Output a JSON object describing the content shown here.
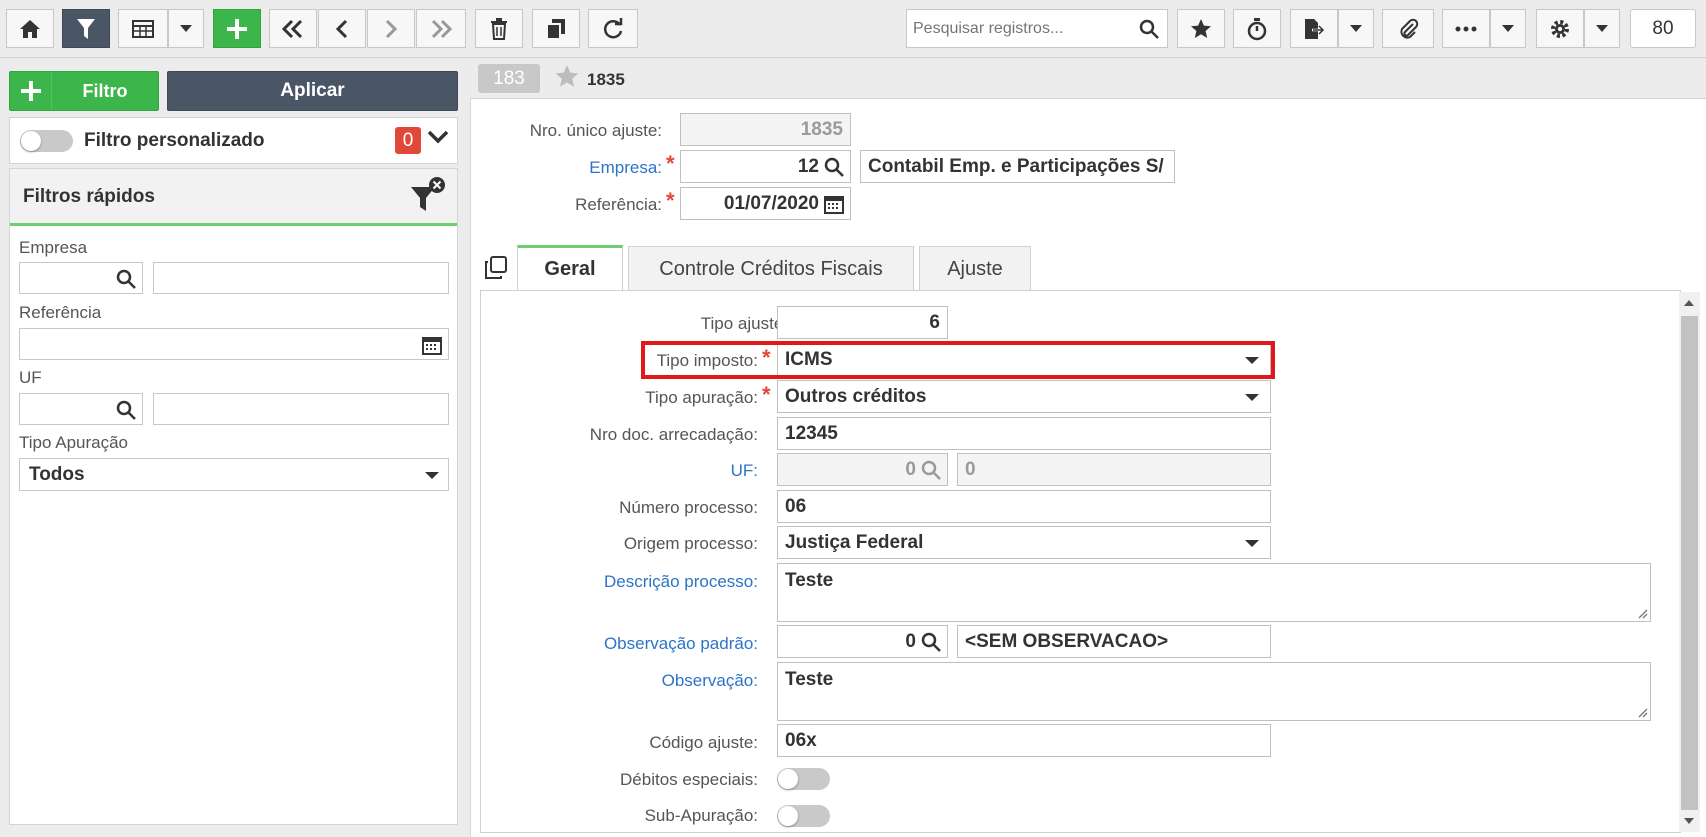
{
  "toolbar": {
    "search_placeholder": "Pesquisar registros...",
    "counter": "80",
    "icons": [
      "home-icon",
      "filter-icon",
      "grid-icon",
      "chevron-down-icon",
      "plus-icon",
      "first-icon",
      "prev-icon",
      "next-icon",
      "last-icon",
      "trash-icon",
      "copy-icon",
      "refresh-icon",
      "search-icon",
      "star-icon",
      "stopwatch-icon",
      "export-icon",
      "paperclip-icon",
      "more-icon",
      "gear-icon"
    ]
  },
  "filters": {
    "add_label": "Filtro",
    "apply_label": "Aplicar",
    "custom_label": "Filtro personalizado",
    "custom_count": "0",
    "quick_title": "Filtros rápidos",
    "empresa_label": "Empresa",
    "referencia_label": "Referência",
    "uf_label": "UF",
    "tipo_apuracao_label": "Tipo Apuração",
    "tipo_apuracao_value": "Todos"
  },
  "record": {
    "tab_badge": "183",
    "number": "1835"
  },
  "header_form": {
    "nro_unico_label": "Nro. único ajuste:",
    "nro_unico_value": "1835",
    "empresa_label": "Empresa:",
    "empresa_code": "12",
    "empresa_name": "Contabil Emp. e Participações S/",
    "referencia_label": "Referência:",
    "referencia_value": "01/07/2020"
  },
  "tabs": [
    {
      "label": "Geral",
      "active": true
    },
    {
      "label": "Controle Créditos Fiscais",
      "active": false
    },
    {
      "label": "Ajuste",
      "active": false
    }
  ],
  "geral": {
    "tipo_ajuste_label": "Tipo ajuste:",
    "tipo_ajuste_value": "6",
    "tipo_imposto_label": "Tipo imposto:",
    "tipo_imposto_value": "ICMS",
    "tipo_apuracao_label": "Tipo apuração:",
    "tipo_apuracao_value": "Outros créditos",
    "nro_doc_label": "Nro doc. arrecadação:",
    "nro_doc_value": "12345",
    "uf_label": "UF:",
    "uf_code": "0",
    "uf_name": "0",
    "numero_processo_label": "Número processo:",
    "numero_processo_value": "06",
    "origem_processo_label": "Origem processo:",
    "origem_processo_value": "Justiça Federal",
    "descricao_processo_label": "Descrição processo:",
    "descricao_processo_value": "Teste",
    "observacao_padrao_label": "Observação padrão:",
    "observacao_padrao_code": "0",
    "observacao_padrao_name": "<SEM OBSERVACAO>",
    "observacao_label": "Observação:",
    "observacao_value": "Teste",
    "codigo_ajuste_label": "Código ajuste:",
    "codigo_ajuste_value": "06x",
    "debitos_especiais_label": "Débitos especiais:",
    "sub_apuracao_label": "Sub-Apuração:"
  },
  "colors": {
    "accent_dark": "#4a5566",
    "accent_green": "#3cb54a",
    "link_blue": "#2c74c7",
    "required_red": "#e0493a",
    "highlight_red": "#e21717"
  }
}
